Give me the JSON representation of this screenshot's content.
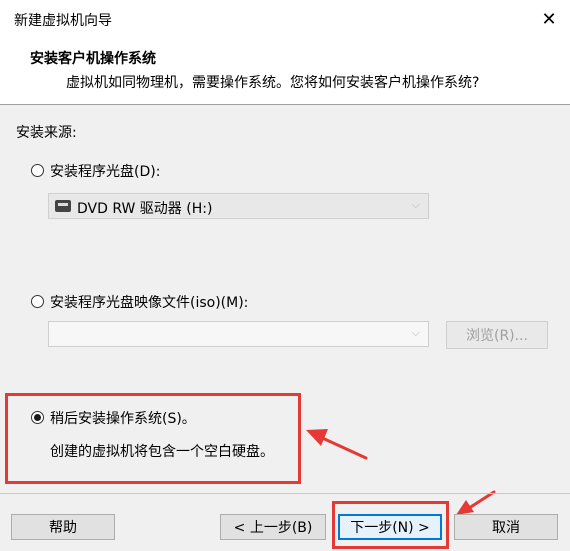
{
  "window": {
    "title": "新建虚拟机向导"
  },
  "header": {
    "title": "安装客户机操作系统",
    "subtitle": "虚拟机如同物理机，需要操作系统。您将如何安装客户机操作系统?"
  },
  "body": {
    "source_label": "安装来源:",
    "option_disc": {
      "label": "安装程序光盘(D):",
      "selected": false
    },
    "disc_combo": {
      "value": "DVD RW 驱动器 (H:)",
      "icon": "dvd-drive-icon"
    },
    "option_iso": {
      "label": "安装程序光盘映像文件(iso)(M):",
      "selected": false
    },
    "iso_combo": {
      "value": ""
    },
    "browse_label": "浏览(R)...",
    "option_later": {
      "label": "稍后安装操作系统(S)。",
      "selected": true
    },
    "later_desc": "创建的虚拟机将包含一个空白硬盘。"
  },
  "footer": {
    "help": "帮助",
    "back": "< 上一步(B)",
    "next": "下一步(N) >",
    "cancel": "取消"
  },
  "colors": {
    "highlight": "#e53935",
    "accent": "#0078d7"
  }
}
